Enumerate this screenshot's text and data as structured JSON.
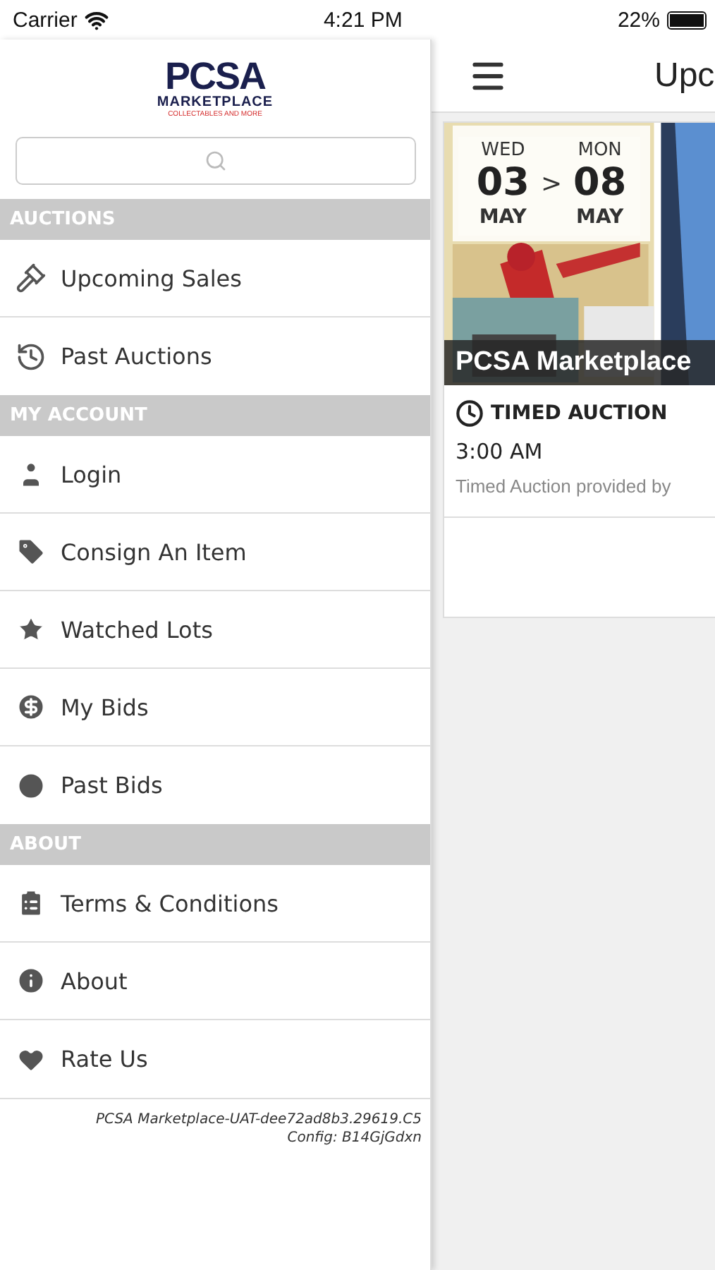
{
  "status_bar": {
    "carrier": "Carrier",
    "time": "4:21 PM",
    "battery": "22%"
  },
  "drawer": {
    "logo": {
      "title": "PCSA",
      "subtitle": "MARKETPLACE",
      "tagline": "COLLECTABLES AND MORE"
    },
    "sections": [
      {
        "title": "AUCTIONS",
        "items": [
          {
            "label": "Upcoming Sales"
          },
          {
            "label": "Past Auctions"
          }
        ]
      },
      {
        "title": "MY ACCOUNT",
        "items": [
          {
            "label": "Login"
          },
          {
            "label": "Consign An Item"
          },
          {
            "label": "Watched Lots"
          },
          {
            "label": "My Bids"
          },
          {
            "label": "Past Bids"
          }
        ]
      },
      {
        "title": "ABOUT",
        "items": [
          {
            "label": "Terms & Conditions"
          },
          {
            "label": "About"
          },
          {
            "label": "Rate Us"
          }
        ]
      }
    ],
    "version": "PCSA Marketplace-UAT-dee72ad8b3.29619.C5",
    "config": "Config: B14GjGdxn"
  },
  "page": {
    "title": "Upc",
    "card": {
      "start": {
        "weekday": "WED",
        "day": "03",
        "month": "MAY"
      },
      "separator": ">",
      "end": {
        "weekday": "MON",
        "day": "08",
        "month": "MAY"
      },
      "name": "PCSA Marketplace",
      "type": "TIMED AUCTION",
      "time": "3:00 AM",
      "description": "Timed Auction provided by"
    }
  }
}
